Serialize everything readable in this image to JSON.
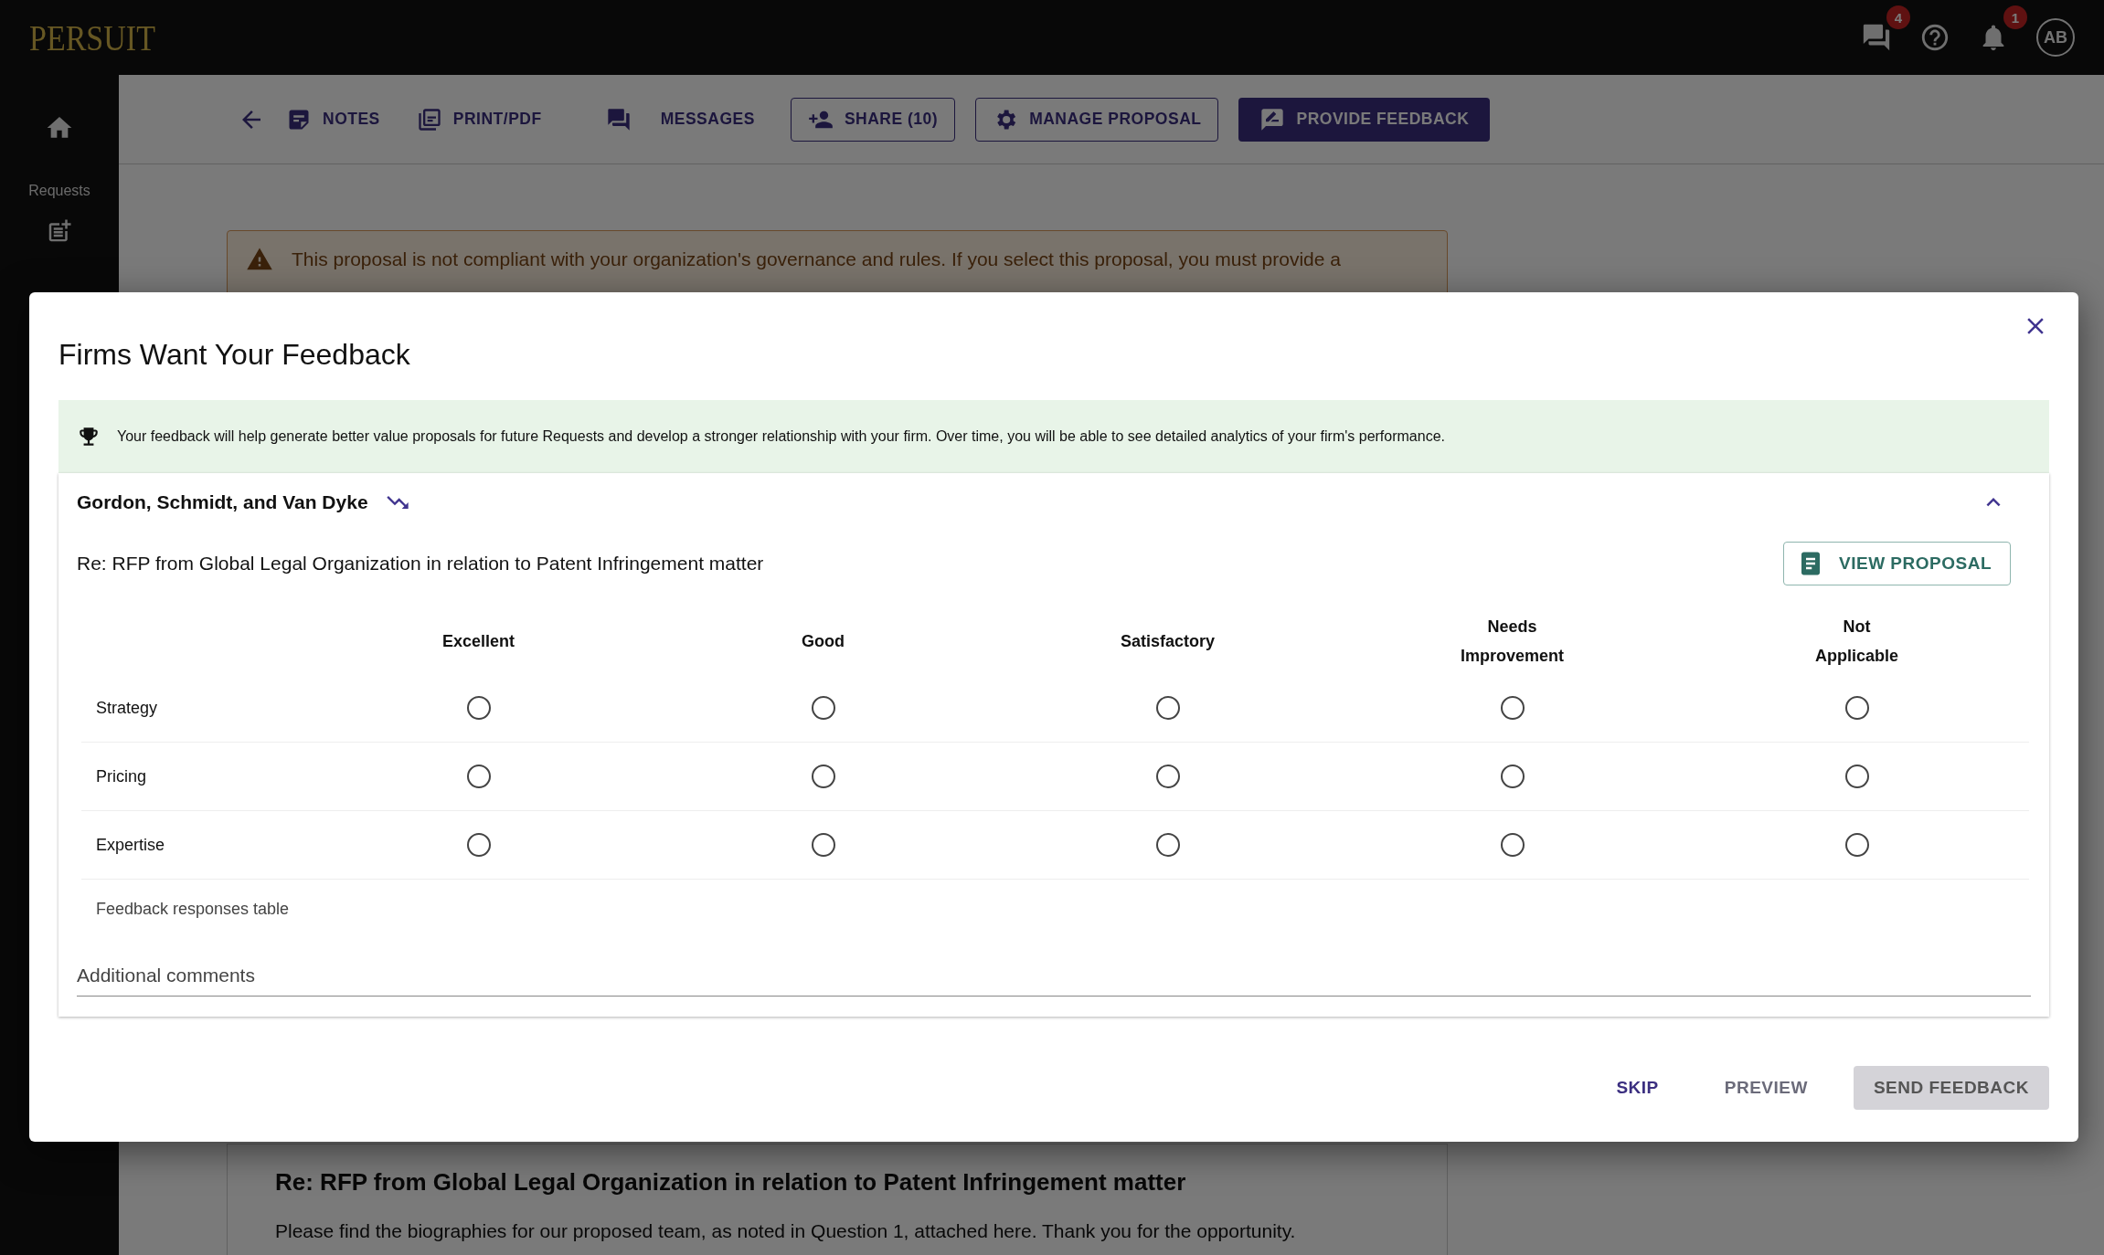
{
  "top_bar": {
    "logo": "PERSUIT",
    "messages_badge": "4",
    "notifications_badge": "1",
    "avatar": "AB"
  },
  "sidebar": {
    "label": "Requests"
  },
  "toolbar": {
    "buttons": [
      {
        "kind": "back"
      },
      {
        "kind": "text",
        "label": "NOTES"
      },
      {
        "kind": "text",
        "label": "PRINT/PDF"
      },
      {
        "kind": "text",
        "label": "MESSAGES"
      },
      {
        "kind": "outlined",
        "label": "SHARE (10)"
      },
      {
        "kind": "outlined",
        "label": "MANAGE PROPOSAL"
      },
      {
        "kind": "contained",
        "label": "PROVIDE FEEDBACK"
      }
    ]
  },
  "warning": {
    "text": "This proposal is not compliant with your organization's governance and rules. If you select this proposal, you must provide a"
  },
  "response_card": {
    "title": "Re: RFP from Global Legal Organization in relation to Patent Infringement matter",
    "body": "Please find the biographies for our proposed team, as noted in Question 1, attached here. Thank you for the opportunity."
  },
  "dialog": {
    "title": "Firms Want Your Feedback",
    "info": "Your feedback will help generate better value proposals for future Requests and develop a stronger relationship with your firm. Over time, you will be able to see detailed analytics of your firm's performance.",
    "firm": {
      "name": "Gordon, Schmidt, and Van Dyke",
      "expanded": true,
      "subject": "Re: RFP from Global Legal Organization in relation to Patent Infringement matter",
      "view_button": "VIEW PROPOSAL"
    },
    "table": {
      "columns": [
        [
          "Excellent"
        ],
        [
          "Good"
        ],
        [
          "Satisfactory"
        ],
        [
          "Needs",
          "Improvement"
        ],
        [
          "Not",
          "Applicable"
        ]
      ],
      "rows": [
        {
          "label": "Strategy",
          "options": [
            {
              "selected": false
            },
            {
              "selected": false
            },
            {
              "selected": false
            },
            {
              "selected": false
            },
            {
              "selected": false
            }
          ]
        },
        {
          "label": "Pricing",
          "options": [
            {
              "selected": false
            },
            {
              "selected": false
            },
            {
              "selected": false
            },
            {
              "selected": false
            },
            {
              "selected": false
            }
          ]
        },
        {
          "label": "Expertise",
          "options": [
            {
              "selected": false
            },
            {
              "selected": false
            },
            {
              "selected": false
            },
            {
              "selected": false
            },
            {
              "selected": false
            }
          ]
        }
      ],
      "caption": "Feedback responses table"
    },
    "comments": {
      "placeholder": "Additional comments"
    },
    "buttons": [
      {
        "kind": "primary",
        "label": "SKIP",
        "disabled": false
      },
      {
        "kind": "secondary",
        "label": "PREVIEW",
        "disabled": false
      },
      {
        "kind": "contained",
        "label": "SEND FEEDBACK",
        "disabled": true
      }
    ]
  }
}
